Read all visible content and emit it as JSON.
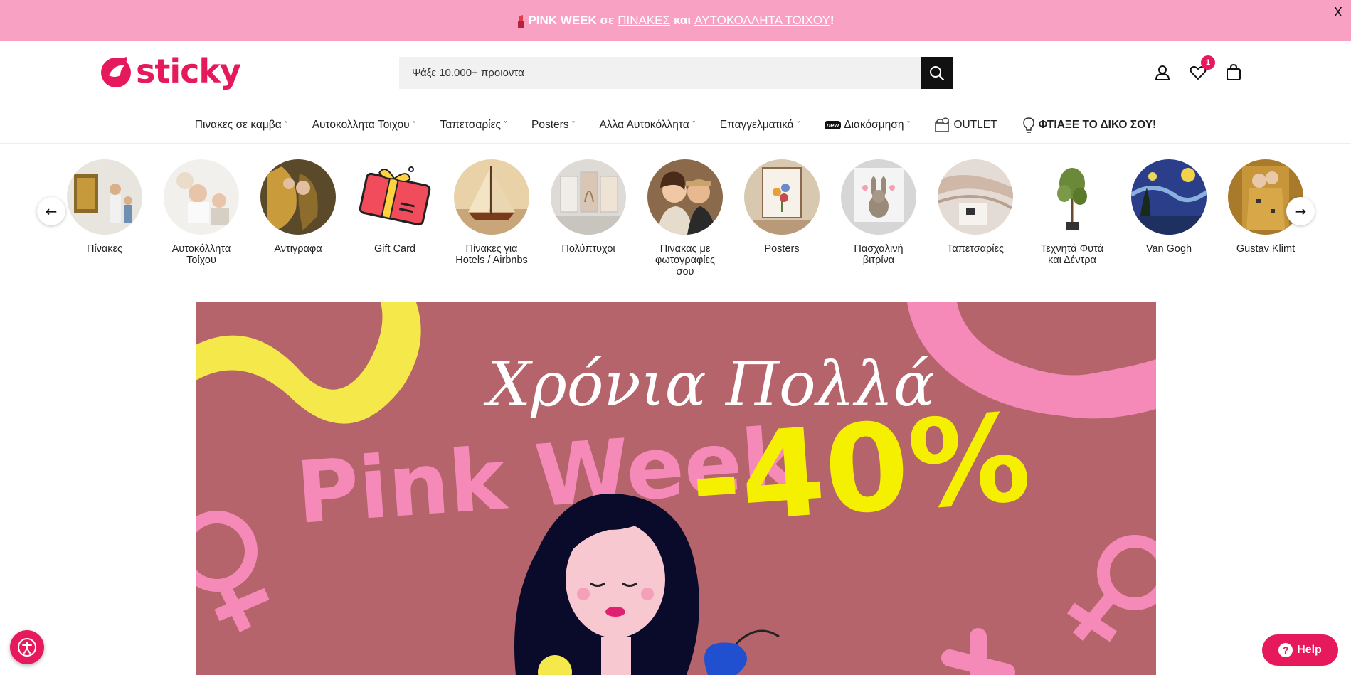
{
  "announcement": {
    "bold_text": "PINK WEEK σε",
    "link1": "ΠΙΝΑΚΕΣ",
    "middle": "και",
    "link2": "ΑΥΤΟΚΟΛΛΗΤΑ ΤΟΙΧΟΥ",
    "end": "!",
    "close": "X"
  },
  "logo": {
    "text": "sticky"
  },
  "search": {
    "placeholder": "Ψάξε 10.000+ προιοντα"
  },
  "header_icons": {
    "wishlist_count": "1"
  },
  "nav": [
    {
      "label": "Πινακες σε καμβα",
      "chevron": "˅"
    },
    {
      "label": "Αυτοκολλητα Τοιχου",
      "chevron": "˅"
    },
    {
      "label": "Ταπετσαρίες",
      "chevron": "˅"
    },
    {
      "label": "Posters",
      "chevron": "˅"
    },
    {
      "label": "Αλλα Αυτοκόλλητα",
      "chevron": "˅"
    },
    {
      "label": "Επαγγελματικά",
      "chevron": "˅"
    },
    {
      "label": "Διακόσμηση",
      "chevron": "˅",
      "tag": "new"
    },
    {
      "label": "OUTLET"
    },
    {
      "label": "ΦΤΙΑΞΕ ΤΟ ΔΙΚΟ ΣΟΥ!"
    }
  ],
  "categories": [
    {
      "label": "Πίνακες"
    },
    {
      "label": "Αυτοκόλλητα Τοίχου"
    },
    {
      "label": "Αντιγραφα"
    },
    {
      "label": "Gift Card"
    },
    {
      "label": "Πίνακες για Hotels / Airbnbs"
    },
    {
      "label": "Πολύπτυχοι"
    },
    {
      "label": "Πινακας με φωτογραφίες σου"
    },
    {
      "label": "Posters"
    },
    {
      "label": "Πασχαλινή βιτρίνα"
    },
    {
      "label": "Ταπετσαρίες"
    },
    {
      "label": "Τεχνητά Φυτά και Δέντρα"
    },
    {
      "label": "Van Gogh"
    },
    {
      "label": "Gustav Klimt"
    }
  ],
  "carousel": {
    "prev": "←",
    "next": "→"
  },
  "hero": {
    "script_text": "Χρόνια Πολλά",
    "title": "Pink Week",
    "discount": "-40%"
  },
  "help": {
    "label": "Help",
    "icon": "?"
  },
  "colors": {
    "brand": "#e6195c",
    "announce_bg": "#f9a1c3",
    "hero_bg": "#b5646b"
  }
}
